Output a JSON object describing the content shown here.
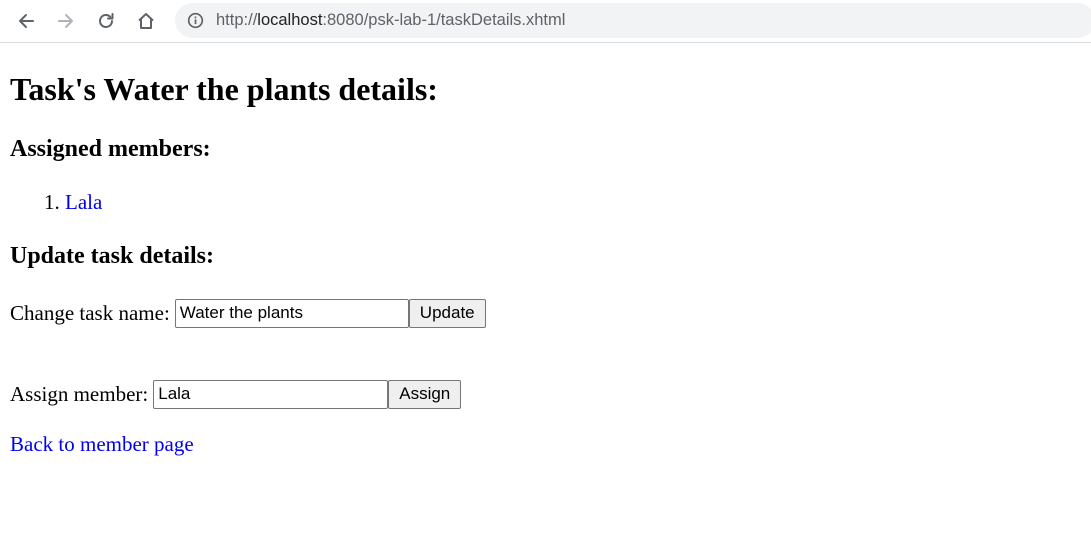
{
  "browser": {
    "url_scheme": "http://",
    "url_host": "localhost",
    "url_rest": ":8080/psk-lab-1/taskDetails.xhtml"
  },
  "page": {
    "title": "Task's Water the plants details:",
    "assigned_heading": "Assigned members:",
    "members": [
      {
        "number": "1.",
        "name": "Lala"
      }
    ],
    "update_heading": "Update task details:",
    "task_name_label": "Change task name:",
    "task_name_value": "Water the plants",
    "update_button": "Update",
    "assign_label": "Assign member:",
    "assign_value": "Lala",
    "assign_button": "Assign",
    "back_link": "Back to member page"
  },
  "colors": {
    "link": "#0000ee",
    "omnibox_bg": "#f1f3f4",
    "button_bg": "#efefef"
  }
}
